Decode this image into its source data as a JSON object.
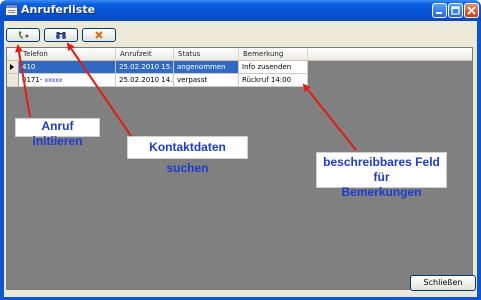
{
  "window": {
    "title": "Anruferliste"
  },
  "toolbar": {
    "call_icon": "phone-icon",
    "search_icon": "binoculars-icon",
    "delete_icon": "delete-icon"
  },
  "table": {
    "columns": [
      "Telefon",
      "Anrufzeit",
      "Status",
      "Bemerkung"
    ],
    "rows": [
      {
        "telefon": "410",
        "anrufzeit": "25.02.2010 15...",
        "status": "angenommen",
        "bemerkung": "Info zusenden"
      },
      {
        "telefon": "0171-",
        "masked": "xxxxx",
        "anrufzeit": "25.02.2010 14...",
        "status": "verpasst",
        "bemerkung": "Rückruf 14:00"
      }
    ]
  },
  "annotations": {
    "call": "Anruf initiieren",
    "search": "Kontaktdaten suchen",
    "remark_line1": "beschreibbares Feld für",
    "remark_line2": "Bemerkungen"
  },
  "footer": {
    "close_label": "Schließen"
  },
  "colors": {
    "title_bar": "#0a55d8",
    "selection": "#316ac5",
    "annotation_text": "#1d3bd0",
    "arrow": "#e41b13"
  }
}
